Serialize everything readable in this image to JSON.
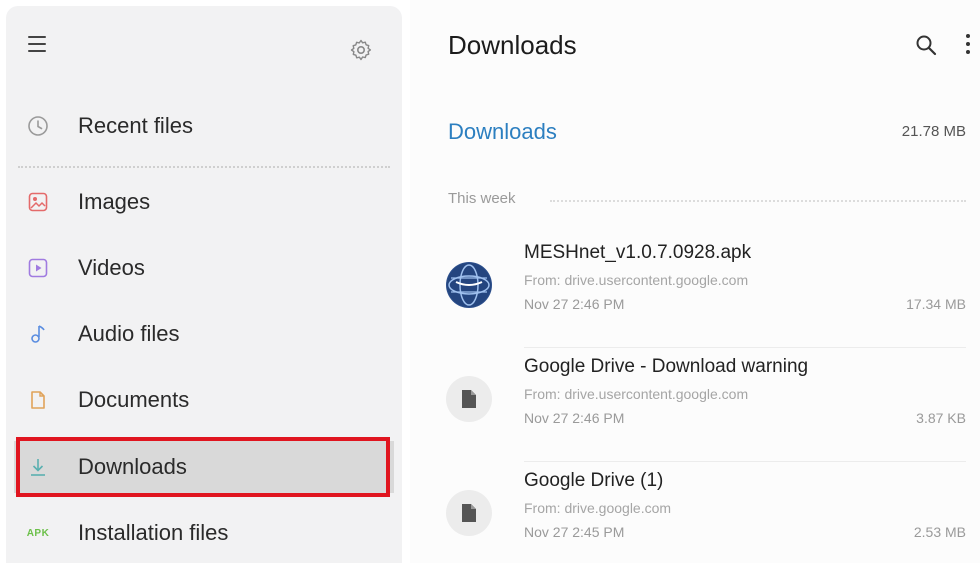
{
  "sidebar": {
    "items": [
      {
        "label": "Recent files",
        "icon": "clock-icon"
      },
      {
        "label": "Images",
        "icon": "image-icon"
      },
      {
        "label": "Videos",
        "icon": "video-icon"
      },
      {
        "label": "Audio files",
        "icon": "music-note-icon"
      },
      {
        "label": "Documents",
        "icon": "document-icon"
      },
      {
        "label": "Downloads",
        "icon": "download-icon",
        "selected": true
      },
      {
        "label": "Installation files",
        "icon": "apk-icon",
        "badge": "APK"
      }
    ]
  },
  "main": {
    "title": "Downloads",
    "location": {
      "label": "Downloads",
      "size": "21.78 MB"
    },
    "section_label": "This week",
    "files": [
      {
        "name": "MESHnet_v1.0.7.0928.apk",
        "source": "From: drive.usercontent.google.com",
        "date": "Nov 27 2:46 PM",
        "size": "17.34 MB",
        "icon": "apk-globe-icon"
      },
      {
        "name": "Google Drive - Download warning",
        "source": "From: drive.usercontent.google.com",
        "date": "Nov 27 2:46 PM",
        "size": "3.87 KB",
        "icon": "file-icon"
      },
      {
        "name": "Google Drive (1)",
        "source": "From: drive.google.com",
        "date": "Nov 27 2:45 PM",
        "size": "2.53 MB",
        "icon": "file-icon"
      }
    ]
  },
  "colors": {
    "accent": "#2c7fc0",
    "highlight": "#e0151f",
    "sidebar_bg": "#f2f2f3",
    "selected_bg": "#d9d9d9"
  }
}
